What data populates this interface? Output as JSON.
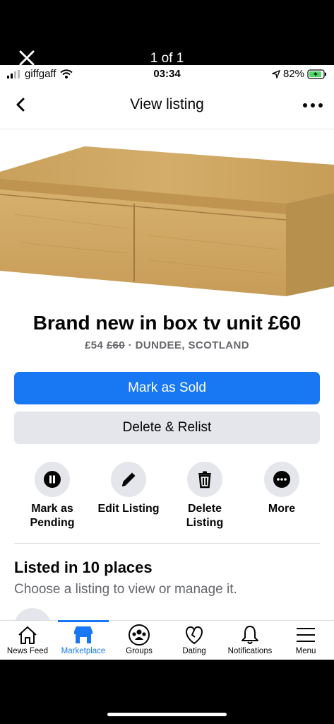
{
  "viewer": {
    "counter": "1 of 1"
  },
  "status_bar": {
    "carrier": "giffgaff",
    "time": "03:34",
    "battery": "82%"
  },
  "header": {
    "title": "View listing"
  },
  "listing": {
    "title": "Brand new in box tv unit £60",
    "price": "£54",
    "old_price": "£60",
    "location": "· DUNDEE, SCOTLAND"
  },
  "buttons": {
    "mark_sold": "Mark as Sold",
    "delete_relist": "Delete & Relist"
  },
  "actions": [
    {
      "label_line1": "Mark as",
      "label_line2": "Pending",
      "icon": "pause-icon"
    },
    {
      "label_line1": "Edit Listing",
      "label_line2": "",
      "icon": "pencil-icon"
    },
    {
      "label_line1": "Delete",
      "label_line2": "Listing",
      "icon": "trash-icon"
    },
    {
      "label_line1": "More",
      "label_line2": "",
      "icon": "more-icon"
    }
  ],
  "places": {
    "title": "Listed in 10 places",
    "subtitle": "Choose a listing to view or manage it."
  },
  "tabs": [
    {
      "label": "News Feed",
      "icon": "home-icon"
    },
    {
      "label": "Marketplace",
      "icon": "shop-icon",
      "active": true
    },
    {
      "label": "Groups",
      "icon": "groups-icon"
    },
    {
      "label": "Dating",
      "icon": "heart-icon"
    },
    {
      "label": "Notifications",
      "icon": "bell-icon"
    },
    {
      "label": "Menu",
      "icon": "menu-icon"
    }
  ],
  "colors": {
    "accent": "#1877f2",
    "secondary_button": "#e4e6eb",
    "muted_text": "#65676b",
    "battery_fill": "#4cd964"
  }
}
